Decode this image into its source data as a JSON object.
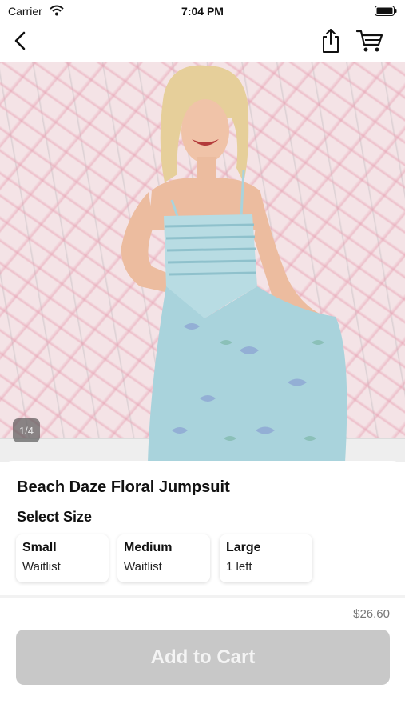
{
  "status_bar": {
    "carrier": "Carrier",
    "time": "7:04 PM",
    "icons": [
      "wifi-icon",
      "battery-icon"
    ]
  },
  "nav": {
    "icons": [
      "back-chevron-icon",
      "share-icon",
      "cart-icon"
    ]
  },
  "gallery": {
    "counter": "1/4",
    "current_index": 1,
    "total": 4
  },
  "product": {
    "title": "Beach Daze Floral Jumpsuit",
    "size_heading": "Select Size",
    "sizes": [
      {
        "name": "Small",
        "status": "Waitlist"
      },
      {
        "name": "Medium",
        "status": "Waitlist"
      },
      {
        "name": "Large",
        "status": "1 left"
      }
    ],
    "price": "$26.60",
    "add_to_cart_label": "Add to Cart"
  },
  "colors": {
    "button_disabled_bg": "#c8c8c8",
    "button_disabled_text": "#f4f4f4",
    "dress": "#a9d3dc",
    "wall_pink": "#e8a0b2"
  }
}
